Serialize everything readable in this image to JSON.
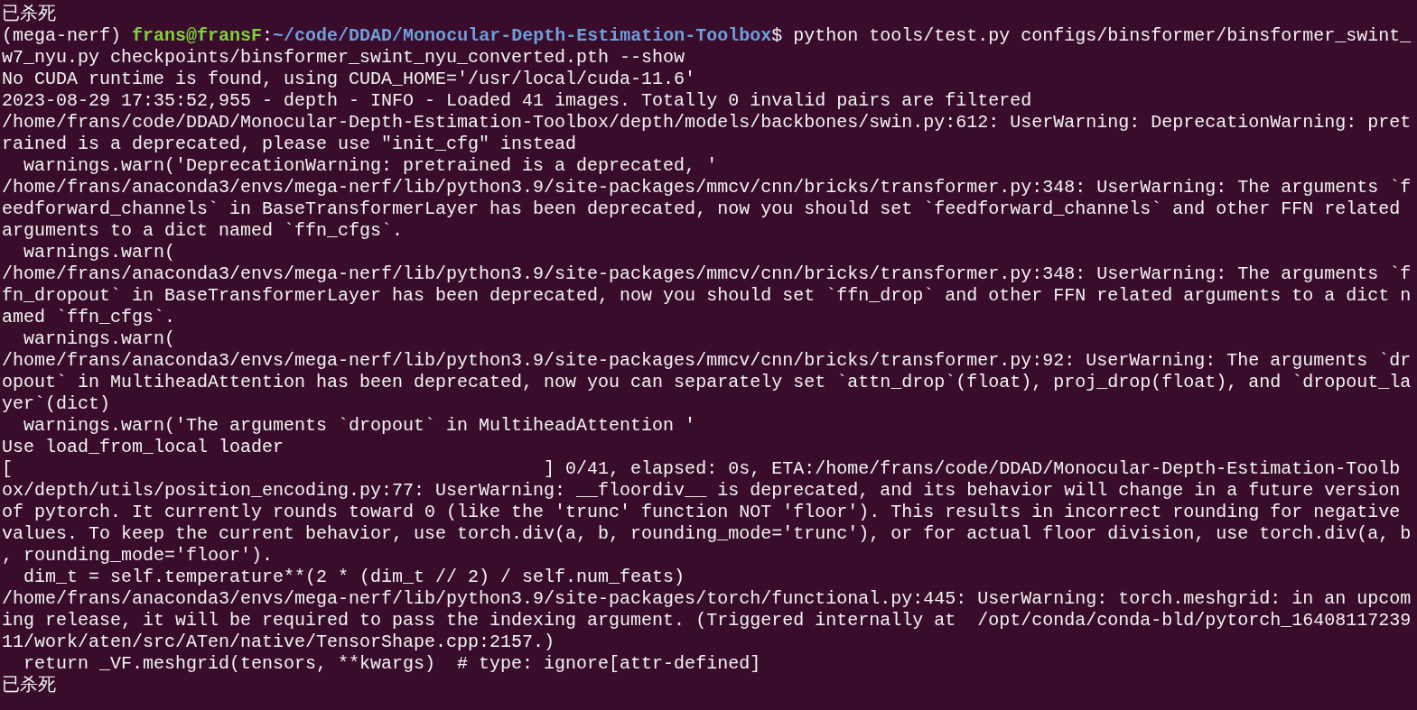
{
  "terminal": {
    "lines": [
      {
        "kind": "output",
        "text": "已杀死"
      },
      {
        "kind": "prompt",
        "env": "(mega-nerf)",
        "user_host": "frans@fransF",
        "separator": ":",
        "path": "~/code/DDAD/Monocular-Depth-Estimation-Toolbox",
        "command": "$ python tools/test.py configs/binsformer/binsformer_swint_"
      },
      {
        "kind": "output",
        "text": "w7_nyu.py checkpoints/binsformer_swint_nyu_converted.pth --show"
      },
      {
        "kind": "output",
        "text": "No CUDA runtime is found, using CUDA_HOME='/usr/local/cuda-11.6'"
      },
      {
        "kind": "output",
        "text": "2023-08-29 17:35:52,955 - depth - INFO - Loaded 41 images. Totally 0 invalid pairs are filtered"
      },
      {
        "kind": "output",
        "text": "/home/frans/code/DDAD/Monocular-Depth-Estimation-Toolbox/depth/models/backbones/swin.py:612: UserWarning: DeprecationWarning: pret"
      },
      {
        "kind": "output",
        "text": "rained is a deprecated, please use \"init_cfg\" instead"
      },
      {
        "kind": "output",
        "text": "  warnings.warn('DeprecationWarning: pretrained is a deprecated, '"
      },
      {
        "kind": "output",
        "text": "/home/frans/anaconda3/envs/mega-nerf/lib/python3.9/site-packages/mmcv/cnn/bricks/transformer.py:348: UserWarning: The arguments `f"
      },
      {
        "kind": "output",
        "text": "eedforward_channels` in BaseTransformerLayer has been deprecated, now you should set `feedforward_channels` and other FFN related"
      },
      {
        "kind": "output",
        "text": "arguments to a dict named `ffn_cfgs`."
      },
      {
        "kind": "output",
        "text": "  warnings.warn("
      },
      {
        "kind": "output",
        "text": "/home/frans/anaconda3/envs/mega-nerf/lib/python3.9/site-packages/mmcv/cnn/bricks/transformer.py:348: UserWarning: The arguments `f"
      },
      {
        "kind": "output",
        "text": "fn_dropout` in BaseTransformerLayer has been deprecated, now you should set `ffn_drop` and other FFN related arguments to a dict n"
      },
      {
        "kind": "output",
        "text": "amed `ffn_cfgs`."
      },
      {
        "kind": "output",
        "text": "  warnings.warn("
      },
      {
        "kind": "output",
        "text": "/home/frans/anaconda3/envs/mega-nerf/lib/python3.9/site-packages/mmcv/cnn/bricks/transformer.py:92: UserWarning: The arguments `dr"
      },
      {
        "kind": "output",
        "text": "opout` in MultiheadAttention has been deprecated, now you can separately set `attn_drop`(float), proj_drop(float), and `dropout_la"
      },
      {
        "kind": "output",
        "text": "yer`(dict)"
      },
      {
        "kind": "output",
        "text": "  warnings.warn('The arguments `dropout` in MultiheadAttention '"
      },
      {
        "kind": "output",
        "text": "Use load_from_local loader"
      },
      {
        "kind": "output",
        "text": "[                                                 ] 0/41, elapsed: 0s, ETA:/home/frans/code/DDAD/Monocular-Depth-Estimation-Toolb"
      },
      {
        "kind": "output",
        "text": "ox/depth/utils/position_encoding.py:77: UserWarning: __floordiv__ is deprecated, and its behavior will change in a future version"
      },
      {
        "kind": "output",
        "text": "of pytorch. It currently rounds toward 0 (like the 'trunc' function NOT 'floor'). This results in incorrect rounding for negative"
      },
      {
        "kind": "output",
        "text": "values. To keep the current behavior, use torch.div(a, b, rounding_mode='trunc'), or for actual floor division, use torch.div(a, b"
      },
      {
        "kind": "output",
        "text": ", rounding_mode='floor')."
      },
      {
        "kind": "output",
        "text": "  dim_t = self.temperature**(2 * (dim_t // 2) / self.num_feats)"
      },
      {
        "kind": "output",
        "text": "/home/frans/anaconda3/envs/mega-nerf/lib/python3.9/site-packages/torch/functional.py:445: UserWarning: torch.meshgrid: in an upcom"
      },
      {
        "kind": "output",
        "text": "ing release, it will be required to pass the indexing argument. (Triggered internally at  /opt/conda/conda-bld/pytorch_16408117239"
      },
      {
        "kind": "output",
        "text": "11/work/aten/src/ATen/native/TensorShape.cpp:2157.)"
      },
      {
        "kind": "output",
        "text": "  return _VF.meshgrid(tensors, **kwargs)  # type: ignore[attr-defined]"
      },
      {
        "kind": "output",
        "text": "已杀死"
      }
    ]
  }
}
